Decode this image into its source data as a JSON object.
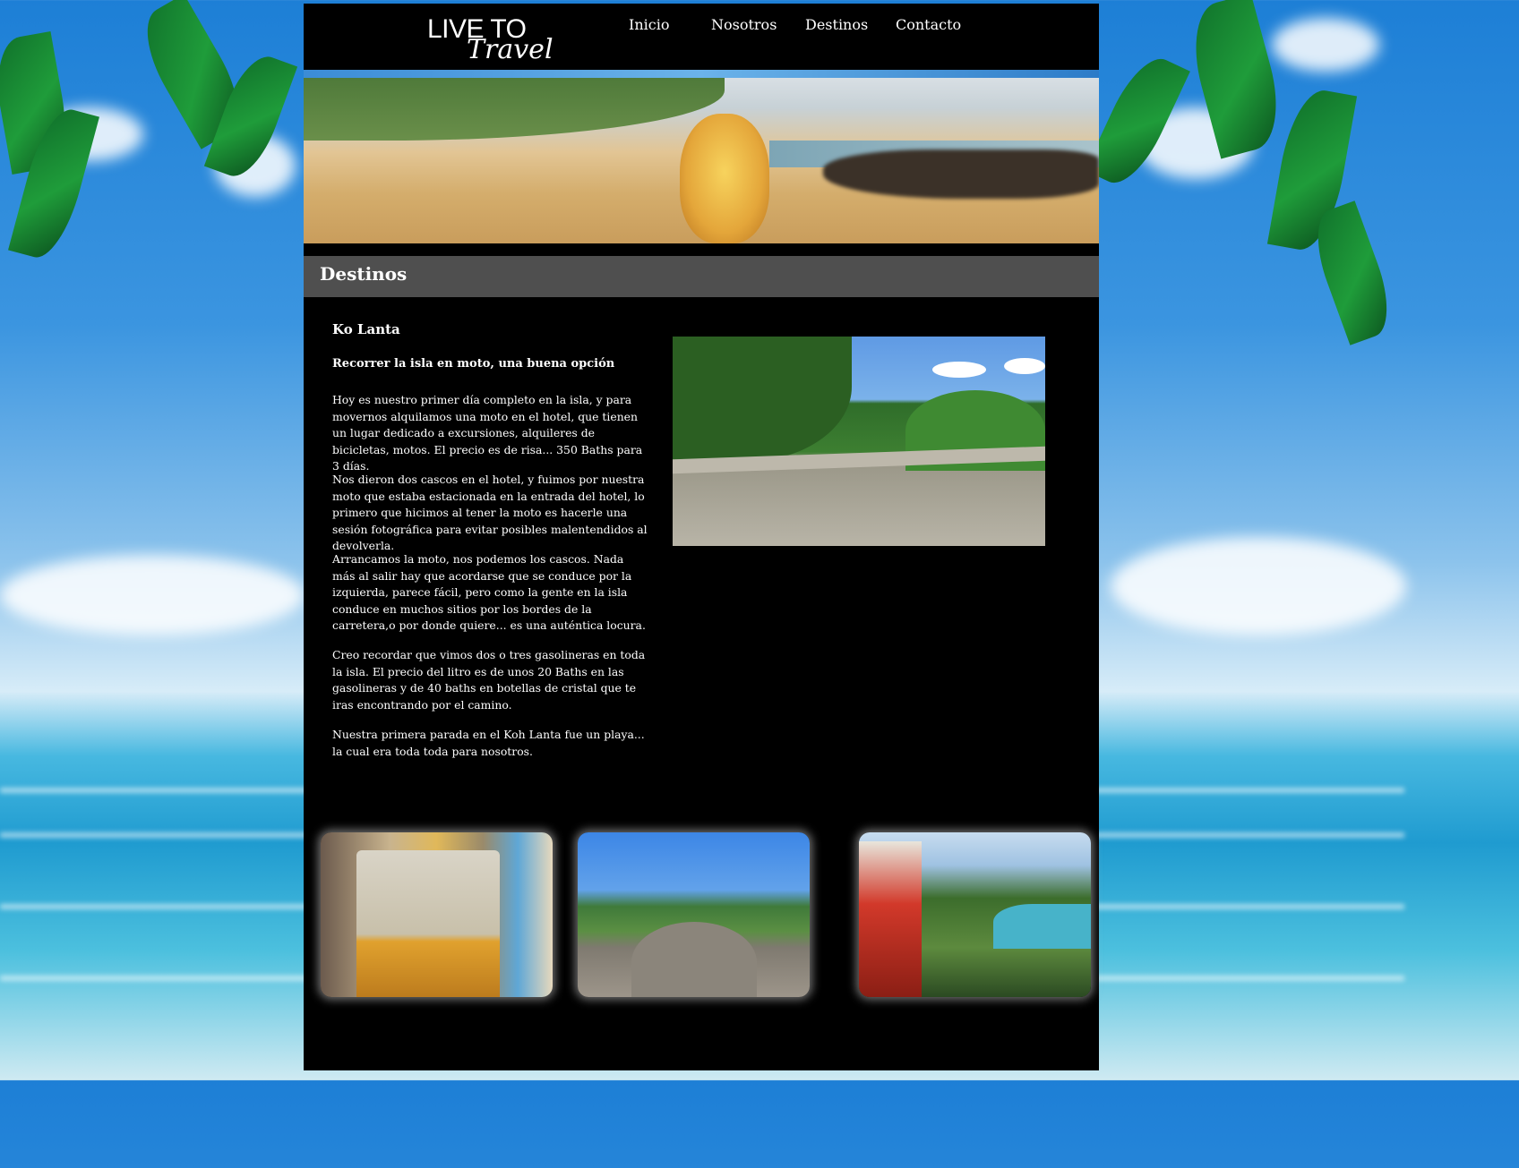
{
  "brand": {
    "line1": "LIVE TO",
    "line2": "Travel"
  },
  "nav": [
    "Inicio",
    "Nosotros",
    "Destinos",
    "Contacto"
  ],
  "page_title": "Destinos",
  "article": {
    "heading": "Ko Lanta",
    "subheading": "Recorrer la isla en moto, una buena opción",
    "paragraphs": [
      "Hoy es nuestro primer día completo en la isla, y para movernos alquilamos una moto en el hotel, que tienen un lugar dedicado a excursiones, alquileres de bicicletas, motos. El precio es de risa... 350 Baths para 3 días.",
      "Nos dieron dos cascos en el hotel, y fuimos por nuestra moto que estaba estacionada en la entrada del hotel, lo primero que hicimos al tener la moto es hacerle una sesión fotográfica para evitar posibles malentendidos al devolverla.",
      "Arrancamos la moto, nos podemos los cascos. Nada más al salir hay que acordarse que se conduce por la izquierda, parece fácil, pero como la gente en la isla conduce en muchos sitios por los bordes de la carretera,o por donde quiere... es una auténtica locura.",
      "Creo recordar que vimos dos o tres gasolineras en toda la isla. El precio del litro es de unos 20 Baths en las gasolineras y de 40 baths en botellas de cristal que te iras encontrando por el camino.",
      "Nuestra primera parada en el Koh Lanta fue un playa... la cual era toda toda para nosotros."
    ]
  },
  "colors": {
    "page_bg": "#000000",
    "title_bar": "#4f4f4f",
    "text": "#ffffff"
  }
}
